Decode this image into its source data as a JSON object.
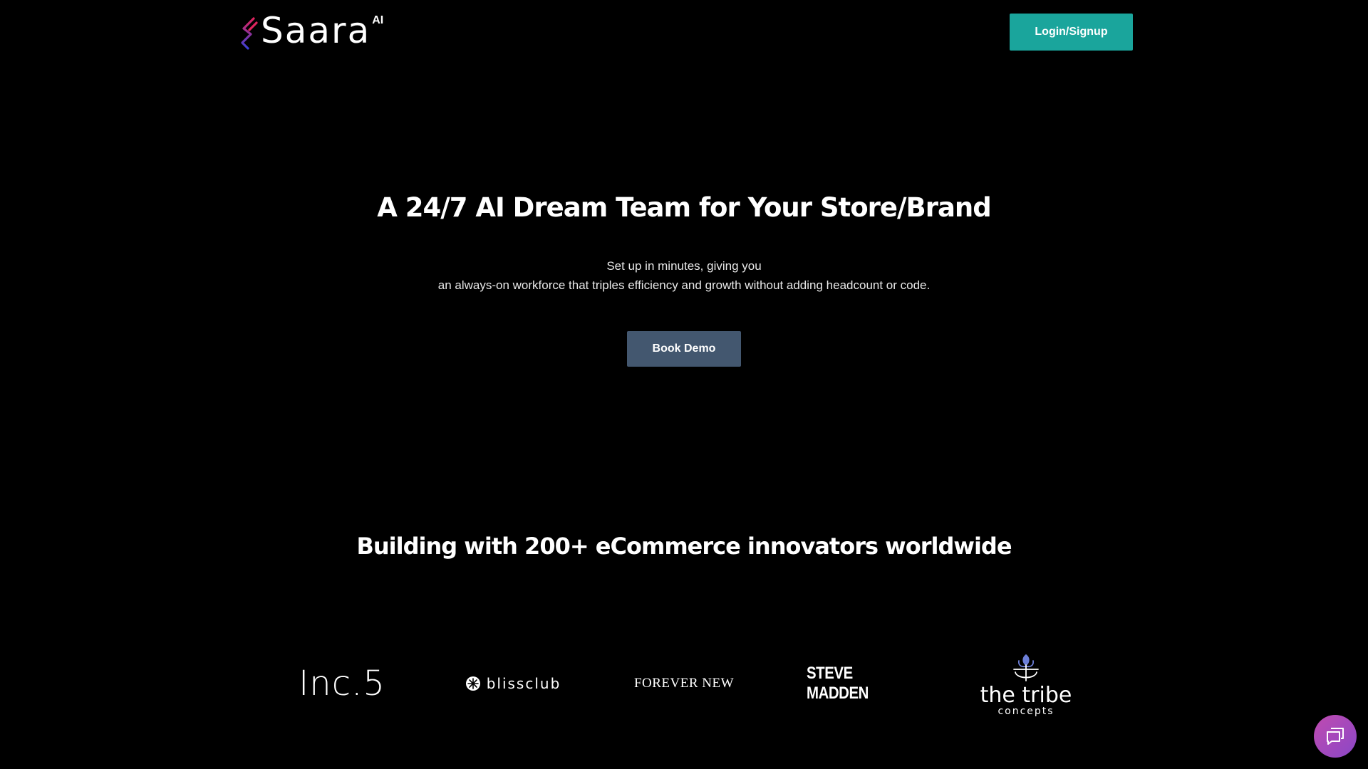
{
  "header": {
    "logo_text": "Saara",
    "logo_superscript": "AI",
    "login_label": "Login/Signup"
  },
  "hero": {
    "title": "A 24/7 AI Dream Team for Your Store/Brand",
    "subtitle_line1": "Set up in minutes, giving you",
    "subtitle_line2": "an always-on workforce that triples efficiency and growth without adding headcount or code.",
    "cta_label": "Book Demo"
  },
  "social_proof": {
    "title": "Building with 200+ eCommerce innovators worldwide",
    "brands": [
      {
        "name": "Inc.5"
      },
      {
        "name": "blissclub"
      },
      {
        "name": "FOREVER NEW"
      },
      {
        "name": "STEVE MADDEN"
      },
      {
        "name": "the tribe",
        "tagline": "concepts"
      }
    ]
  },
  "colors": {
    "background": "#000000",
    "login_button": "#1aa59c",
    "demo_button": "#43576f",
    "chat_gradient_start": "#c04bb0",
    "chat_gradient_end": "#8a47c7"
  },
  "icons": {
    "logo_mark": "saara-s-mark-icon",
    "chat": "chat-bubble-icon"
  }
}
